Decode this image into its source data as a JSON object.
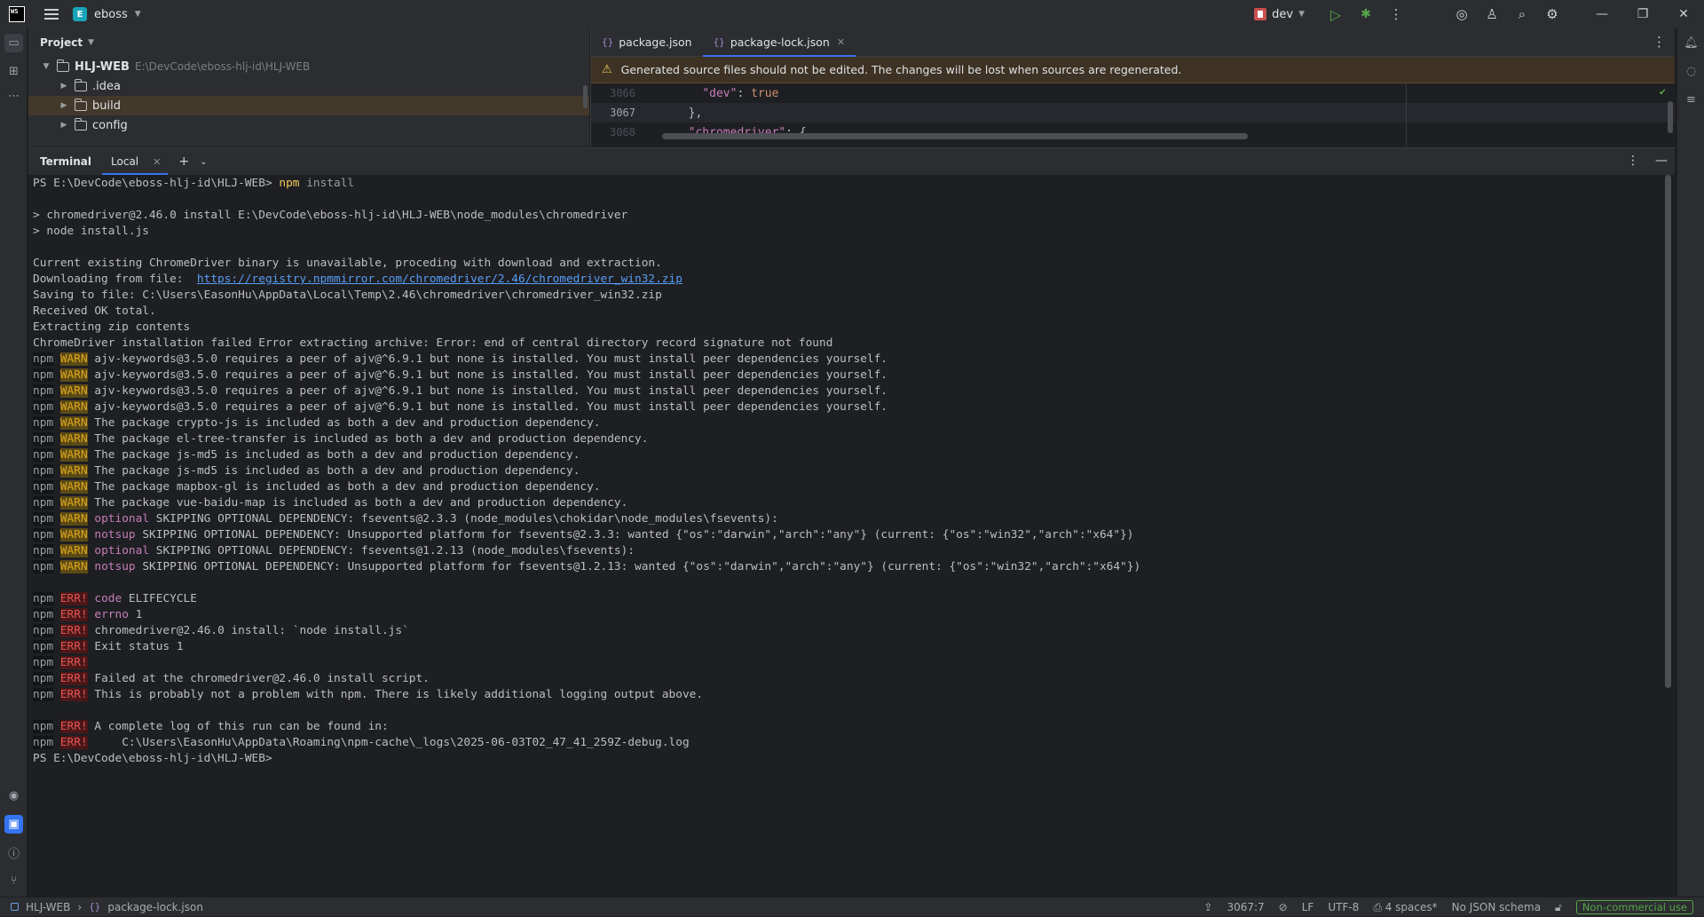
{
  "titlebar": {
    "logo": "WS",
    "project_badge": "E",
    "project_name": "eboss",
    "run_config": "dev",
    "icons": [
      "hamburger-icon",
      "play-icon",
      "debug-icon",
      "more-icon",
      "copilot-icon",
      "account-icon",
      "search-icon",
      "gear-icon"
    ],
    "window_controls": [
      "minimize",
      "restore",
      "close"
    ]
  },
  "project_panel": {
    "title": "Project",
    "root": {
      "name": "HLJ-WEB",
      "path": "E:\\DevCode\\eboss-hlj-id\\HLJ-WEB"
    },
    "items": [
      {
        "name": ".idea"
      },
      {
        "name": "build"
      },
      {
        "name": "config"
      }
    ]
  },
  "editor": {
    "tabs": [
      {
        "label": "package.json",
        "active": false
      },
      {
        "label": "package-lock.json",
        "active": true
      }
    ],
    "banner": "Generated source files should not be edited. The changes will be lost when sources are regenerated.",
    "lines": [
      {
        "num": "3066",
        "key": "\"dev\"",
        "sep": ": ",
        "val": "true",
        "indent": "  "
      },
      {
        "num": "3067",
        "text": "},"
      },
      {
        "num": "3068",
        "key": "\"chromedriver\"",
        "sep": ": {",
        "val": "",
        "indent": ""
      }
    ]
  },
  "terminal": {
    "title": "Terminal",
    "tab": "Local",
    "prompt_cmd": {
      "prompt": "PS E:\\DevCode\\eboss-hlj-id\\HLJ-WEB> ",
      "cmd": "npm",
      "arg": " install"
    },
    "pre_lines": [
      "",
      "> chromedriver@2.46.0 install E:\\DevCode\\eboss-hlj-id\\HLJ-WEB\\node_modules\\chromedriver",
      "> node install.js",
      "",
      "Current existing ChromeDriver binary is unavailable, proceding with download and extraction."
    ],
    "download": {
      "label": "Downloading from file:  ",
      "url": "https://registry.npmmirror.com/chromedriver/2.46/chromedriver_win32.zip"
    },
    "post_lines": [
      "Saving to file: C:\\Users\\EasonHu\\AppData\\Local\\Temp\\2.46\\chromedriver\\chromedriver_win32.zip",
      "Received OK total.",
      "Extracting zip contents",
      "ChromeDriver installation failed Error extracting archive: Error: end of central directory record signature not found"
    ],
    "npm_label": "npm",
    "warn_label": "WARN",
    "err_label": "ERR!",
    "warn_lines": [
      {
        "prefix": "",
        "text": "ajv-keywords@3.5.0 requires a peer of ajv@^6.9.1 but none is installed. You must install peer dependencies yourself."
      },
      {
        "prefix": "",
        "text": "ajv-keywords@3.5.0 requires a peer of ajv@^6.9.1 but none is installed. You must install peer dependencies yourself."
      },
      {
        "prefix": "",
        "text": "ajv-keywords@3.5.0 requires a peer of ajv@^6.9.1 but none is installed. You must install peer dependencies yourself."
      },
      {
        "prefix": "",
        "text": "ajv-keywords@3.5.0 requires a peer of ajv@^6.9.1 but none is installed. You must install peer dependencies yourself."
      },
      {
        "prefix": "",
        "text": "The package crypto-js is included as both a dev and production dependency."
      },
      {
        "prefix": "",
        "text": "The package el-tree-transfer is included as both a dev and production dependency."
      },
      {
        "prefix": "",
        "text": "The package js-md5 is included as both a dev and production dependency."
      },
      {
        "prefix": "",
        "text": "The package js-md5 is included as both a dev and production dependency."
      },
      {
        "prefix": "",
        "text": "The package mapbox-gl is included as both a dev and production dependency."
      },
      {
        "prefix": "",
        "text": "The package vue-baidu-map is included as both a dev and production dependency."
      },
      {
        "prefix": "optional",
        "text": " SKIPPING OPTIONAL DEPENDENCY: fsevents@2.3.3 (node_modules\\chokidar\\node_modules\\fsevents):"
      },
      {
        "prefix": "notsup",
        "text": " SKIPPING OPTIONAL DEPENDENCY: Unsupported platform for fsevents@2.3.3: wanted {\"os\":\"darwin\",\"arch\":\"any\"} (current: {\"os\":\"win32\",\"arch\":\"x64\"})"
      },
      {
        "prefix": "optional",
        "text": " SKIPPING OPTIONAL DEPENDENCY: fsevents@1.2.13 (node_modules\\fsevents):"
      },
      {
        "prefix": "notsup",
        "text": " SKIPPING OPTIONAL DEPENDENCY: Unsupported platform for fsevents@1.2.13: wanted {\"os\":\"darwin\",\"arch\":\"any\"} (current: {\"os\":\"win32\",\"arch\":\"x64\"})"
      }
    ],
    "err_lines_a": [
      {
        "prefix": "code",
        "text": " ELIFECYCLE"
      },
      {
        "prefix": "errno",
        "text": " 1"
      },
      {
        "prefix": "",
        "text": "chromedriver@2.46.0 install: `node install.js`"
      },
      {
        "prefix": "",
        "text": "Exit status 1"
      },
      {
        "prefix": "",
        "text": ""
      },
      {
        "prefix": "",
        "text": "Failed at the chromedriver@2.46.0 install script."
      },
      {
        "prefix": "",
        "text": "This is probably not a problem with npm. There is likely additional logging output above."
      }
    ],
    "err_lines_b": [
      {
        "prefix": "",
        "text": "A complete log of this run can be found in:"
      },
      {
        "prefix": "",
        "text": "    C:\\Users\\EasonHu\\AppData\\Roaming\\npm-cache\\_logs\\2025-06-03T02_47_41_259Z-debug.log"
      }
    ],
    "final_prompt": "PS E:\\DevCode\\eboss-hlj-id\\HLJ-WEB>"
  },
  "statusbar": {
    "breadcrumb_root": "HLJ-WEB",
    "breadcrumb_file": "package-lock.json",
    "position": "3067:7",
    "line_sep": "LF",
    "encoding": "UTF-8",
    "indent": "4 spaces*",
    "schema": "No JSON schema",
    "license": "Non-commercial use"
  }
}
